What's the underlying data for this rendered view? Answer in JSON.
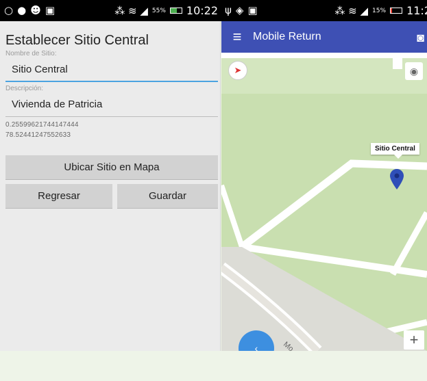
{
  "left_status": {
    "icons": [
      "circle-icon",
      "location-pin-icon",
      "contact-icon",
      "image-icon"
    ],
    "signal_text": "⁂ ≋ ◢",
    "battery_pct": "55%",
    "battery_level": 0.55,
    "time": "10:22"
  },
  "right_status": {
    "icons": [
      "usb-icon",
      "gps-icon",
      "image-icon"
    ],
    "signal_text": "⁂ ≋ ◢",
    "battery_pct": "15%",
    "battery_level": 0.15,
    "time": "11:2"
  },
  "form": {
    "title": "Establecer Sitio Central",
    "name_label": "Nombre de Sitio:",
    "name_value": "Sitio Central",
    "description_label": "Descripción:",
    "description_value": "Vivienda de Patricia",
    "latitude": "0.255996217441474​44",
    "longitude": "78.52441247552633",
    "locate_button": "Ubicar Sitio en Mapa",
    "back_button": "Regresar",
    "save_button": "Guardar"
  },
  "map": {
    "app_title": "Mobile Return",
    "marker_label": "Sitio Central",
    "street_label": "Mo",
    "zoom_in": "+"
  },
  "colors": {
    "appbar": "#3e50b4",
    "map_green": "#c9dfb0",
    "pin": "#2f4fb8",
    "fab": "#3d8fe0"
  }
}
